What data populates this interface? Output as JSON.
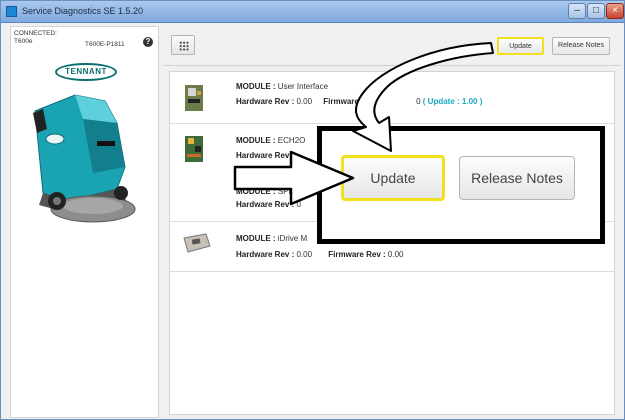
{
  "window": {
    "title": "Service Diagnostics SE 1.5.20",
    "min_glyph": "–",
    "max_glyph": "□",
    "close_glyph": "×"
  },
  "connection": {
    "status_label": "CONNECTED:",
    "model": "T600e",
    "serial": "T600E-P1811",
    "help_glyph": "?"
  },
  "brand": {
    "logo_text": "TENNANT"
  },
  "toolbar": {
    "update_label": "Update",
    "release_notes_label": "Release Notes"
  },
  "modules": [
    {
      "module_label": "MODULE :",
      "name": "User Interface",
      "hw_label": "Hardware Rev :",
      "hw_value": "0.00",
      "fw_label": "Firmware",
      "fw_value": "0",
      "update_text": "( Update : 1.00 )"
    },
    {
      "module_label": "MODULE :",
      "name": "ECH2O",
      "hw_label": "Hardware Rev"
    },
    {
      "module_label": "MODULE :",
      "name": "SPE",
      "hw_label": "Hardware Rev :",
      "hw_value": "0"
    },
    {
      "module_label": "MODULE :",
      "name": "iDrive M",
      "hw_label": "Hardware Rev :",
      "hw_value": "0.00",
      "fw_label": "Firmware Rev :",
      "fw_value": "0.00"
    }
  ],
  "zoom_callout": {
    "update_label": "Update",
    "release_notes_label": "Release Notes"
  },
  "colors": {
    "highlight": "#f0e020",
    "update_link": "#1aa7c2",
    "brand_teal": "#0b6f70",
    "machine_teal": "#19a3b3"
  }
}
